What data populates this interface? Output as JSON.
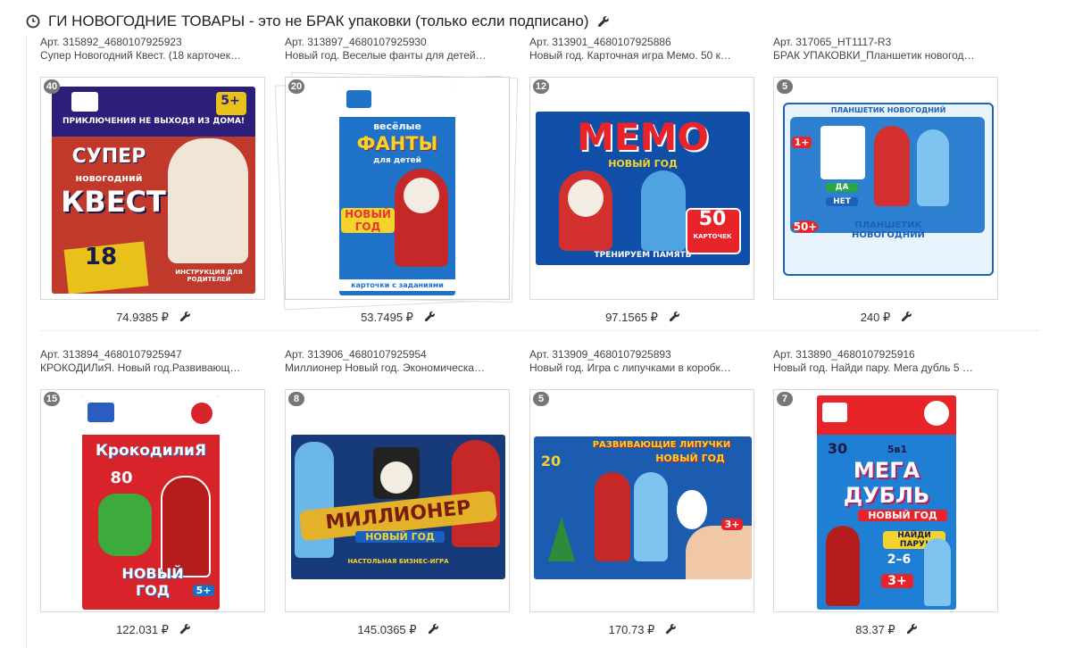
{
  "header": {
    "title": "ГИ НОВОГОДНИЕ ТОВАРЫ - это не БРАК упаковки (только если подписано)"
  },
  "products": [
    {
      "art": "Арт. 315892_4680107925923",
      "name": "Супер Новогодний Квест. (18 карточек…",
      "count": "40",
      "price": "74.9385 ₽",
      "box": {
        "bg": "#2b1f7a",
        "accent": "#e8c21b",
        "lines": [
          "ПРИКЛЮЧЕНИЯ НЕ ВЫХОДЯ ИЗ ДОМА!",
          "СУПЕР",
          "новогодний",
          "КВЕСТ",
          "18",
          "5+",
          "ИНСТРУКЦИЯ ДЛЯ РОДИТЕЛЕЙ"
        ]
      }
    },
    {
      "art": "Арт. 313897_4680107925930",
      "name": "Новый год. Веселые фанты для детей…",
      "count": "20",
      "price": "53.7495 ₽",
      "box": {
        "bg": "#1e73c8",
        "accent": "#f4d42a",
        "lines": [
          "весёлые",
          "ФАНТЫ",
          "для детей",
          "НОВЫЙ ГОД",
          "карточки с заданиями"
        ]
      }
    },
    {
      "art": "Арт. 313901_4680107925886",
      "name": "Новый год. Карточная игра Мемо. 50 к…",
      "count": "12",
      "price": "97.1565 ₽",
      "box": {
        "bg": "#0f4fa8",
        "accent": "#e8232a",
        "lines": [
          "МЕМО",
          "НОВЫЙ ГОД",
          "50",
          "КАРТОЧЕК",
          "ТРЕНИРУЕМ ПАМЯТЬ"
        ]
      }
    },
    {
      "art": "Арт. 317065_HT1117-R3",
      "name": "БРАК УПАКОВКИ_Планшетик новогод…",
      "count": "5",
      "price": "240 ₽",
      "box": {
        "bg": "#e9f3fb",
        "accent": "#1c62b8",
        "lines": [
          "ПЛАНШЕТИК НОВОГОДНИЙ",
          "1+",
          "ДА",
          "НЕТ",
          "50+",
          "ПЛАНШЕТИК НОВОГОДНИЙ"
        ]
      }
    },
    {
      "art": "Арт. 313894_4680107925947",
      "name": "КРОКОДИЛиЯ. Новый год.Развивающ…",
      "count": "15",
      "price": "122.031 ₽",
      "box": {
        "bg": "#d8232a",
        "accent": "#1a6fc4",
        "lines": [
          "КрокодилиЯ",
          "80",
          "НОВЫЙ ГОД",
          "5+"
        ]
      }
    },
    {
      "art": "Арт. 313906_4680107925954",
      "name": "Миллионер Новый год. Экономическа…",
      "count": "8",
      "price": "145.0365 ₽",
      "box": {
        "bg": "#173a7a",
        "accent": "#e3b22a",
        "lines": [
          "МИЛЛИОНЕР",
          "НОВЫЙ ГОД",
          "НАСТОЛЬНАЯ БИЗНЕС-ИГРА"
        ]
      }
    },
    {
      "art": "Арт. 313909_4680107925893",
      "name": "Новый год. Игра с липучками в коробк…",
      "count": "5",
      "price": "170.73 ₽",
      "box": {
        "bg": "#1b5cb0",
        "accent": "#f2d22c",
        "lines": [
          "РАЗВИВАЮЩИЕ ЛИПУЧКИ",
          "НОВЫЙ ГОД",
          "20",
          "3+"
        ]
      }
    },
    {
      "art": "Арт. 313890_4680107925916",
      "name": "Новый год. Найди пару. Мега дубль 5 …",
      "count": "7",
      "price": "83.37 ₽",
      "box": {
        "bg": "#1f7fd4",
        "accent": "#e8232a",
        "lines": [
          "30",
          "5в1",
          "МЕГА",
          "ДУБЛЬ",
          "НОВЫЙ ГОД",
          "НАЙДИ ПАРУ!",
          "2–6",
          "3+"
        ]
      }
    }
  ]
}
